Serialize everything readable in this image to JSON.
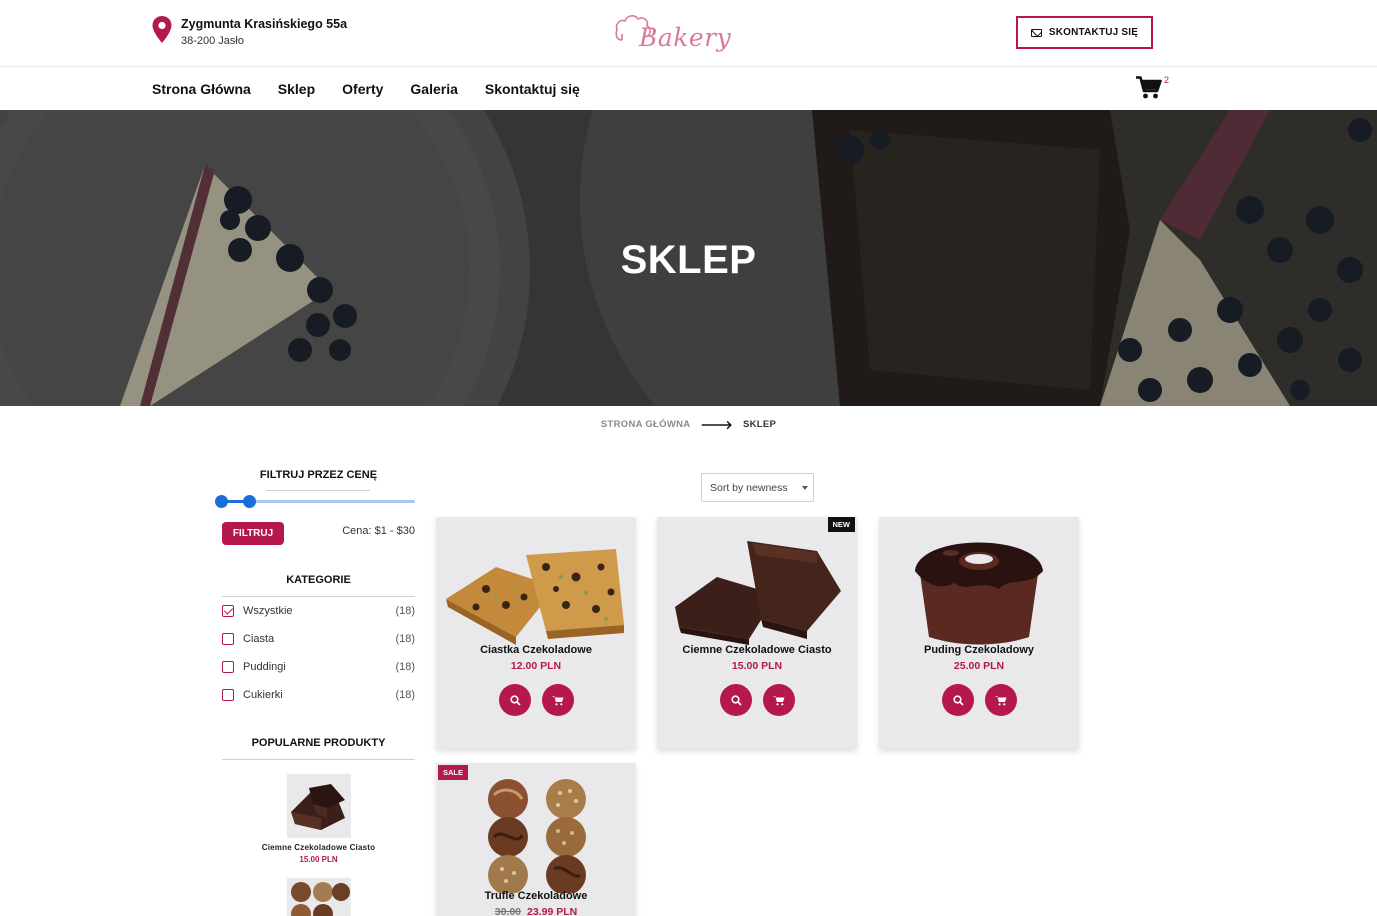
{
  "header": {
    "address_line1": "Zygmunta Krasińskiego 55a",
    "address_line2": "38-200 Jasło",
    "logo_text": "Bakery",
    "contact_button": "SKONTAKTUJ SIĘ"
  },
  "nav": {
    "items": [
      "Strona Główna",
      "Sklep",
      "Oferty",
      "Galeria",
      "Skontaktuj się"
    ],
    "cart_count": "2"
  },
  "hero": {
    "title": "SKLEP"
  },
  "breadcrumb": {
    "home": "STRONA GŁÓWNA",
    "current": "SKLEP"
  },
  "sidebar": {
    "price_filter": {
      "title": "FILTRUJ PRZEZ CENĘ",
      "button": "FILTRUJ",
      "label": "Cena: $1 - $30"
    },
    "categories": {
      "title": "KATEGORIE",
      "items": [
        {
          "name": "Wszystkie",
          "count": "(18)",
          "checked": true
        },
        {
          "name": "Ciasta",
          "count": "(18)",
          "checked": false
        },
        {
          "name": "Puddingi",
          "count": "(18)",
          "checked": false
        },
        {
          "name": "Cukierki",
          "count": "(18)",
          "checked": false
        }
      ]
    },
    "popular": {
      "title": "POPULARNE PRODUKTY",
      "items": [
        {
          "name": "Ciemne Czekoladowe Ciasto",
          "price": "15.00 PLN"
        }
      ]
    }
  },
  "shop": {
    "sort_label": "Sort by newness",
    "products": [
      {
        "name": "Ciastka Czekoladowe",
        "price": "12.00 PLN",
        "old_price": "",
        "badge": ""
      },
      {
        "name": "Ciemne Czekoladowe Ciasto",
        "price": "15.00 PLN",
        "old_price": "",
        "badge": "NEW"
      },
      {
        "name": "Puding Czekoladowy",
        "price": "25.00 PLN",
        "old_price": "",
        "badge": ""
      },
      {
        "name": "Trufle Czekoladowe",
        "price": "23.99 PLN",
        "old_price": "30.00",
        "badge": "SALE"
      }
    ]
  },
  "colors": {
    "accent": "#b5174f",
    "slider": "#1a6fd6",
    "card_bg": "#e9e9ec"
  },
  "icons": {
    "location": "map-pin-icon",
    "mail": "envelope-icon",
    "cart": "shopping-cart-icon",
    "arrow": "arrow-right-icon",
    "search": "magnifier-icon",
    "add_to_cart": "cart-icon"
  }
}
